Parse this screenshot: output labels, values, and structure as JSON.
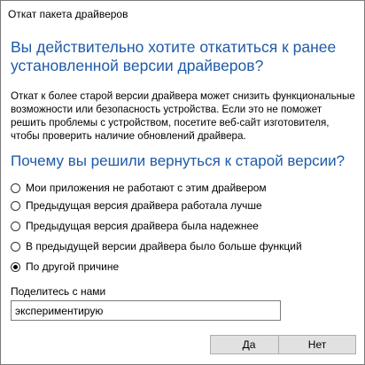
{
  "window": {
    "title": "Откат пакета драйверов"
  },
  "dialog": {
    "heading": "Вы действительно хотите откатиться к ранее установленной версии драйверов?",
    "description": "Откат к более старой версии драйвера может снизить функциональные возможности или безопасность устройства. Если это не поможет решить проблемы с устройством, посетите веб-сайт изготовителя, чтобы проверить наличие обновлений драйвера.",
    "question": "Почему вы решили вернуться к старой версии?",
    "options": [
      {
        "label": "Мои приложения не работают с этим драйвером",
        "checked": false
      },
      {
        "label": "Предыдущая версия драйвера работала лучше",
        "checked": false
      },
      {
        "label": "Предыдущая версия драйвера была надежнее",
        "checked": false
      },
      {
        "label": "В предыдущей версии драйвера было больше функций",
        "checked": false
      },
      {
        "label": "По другой причине",
        "checked": true
      }
    ],
    "share_label": "Поделитесь с нами",
    "share_value": "экспериментирую",
    "yes_label": "Да",
    "no_label": "Нет"
  },
  "colors": {
    "heading": "#1e5aa8",
    "button_bg": "#e1e1e1",
    "border": "#7a7a7a"
  }
}
